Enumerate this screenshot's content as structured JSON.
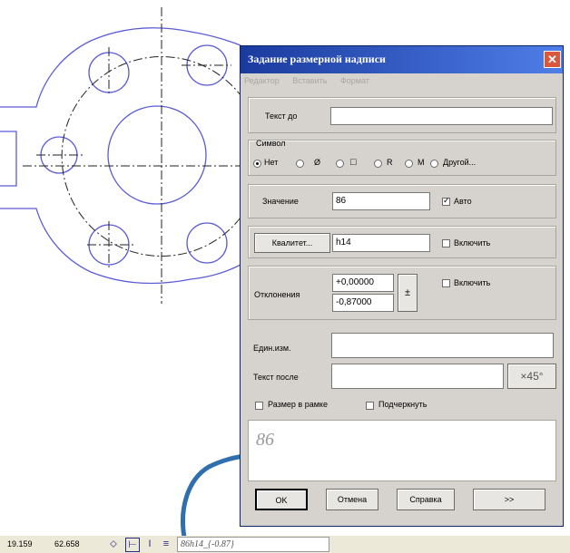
{
  "colors": {
    "drawing_line": "#5b5bd6",
    "center_line": "#222222",
    "title_gradient_start": "#1a3a9e",
    "title_gradient_end": "#4f7ee8",
    "close_button": "#d9583b",
    "arrow": "#2f6fad"
  },
  "dialog": {
    "title": "Задание размерной надписи",
    "close_icon": "✕",
    "menu": [
      "Редактор",
      "Вставить",
      "Формат"
    ],
    "text_before": {
      "label": "Текст до",
      "value": ""
    },
    "symbol": {
      "group_label": "Символ",
      "options": [
        {
          "label": "Нет",
          "selected": true
        },
        {
          "label": "Ø",
          "selected": false
        },
        {
          "label": "□",
          "selected": false
        },
        {
          "label": "R",
          "selected": false
        },
        {
          "label": "M",
          "selected": false
        },
        {
          "label": "Другой...",
          "selected": false
        }
      ]
    },
    "value": {
      "label": "Значение",
      "value": "86",
      "auto_label": "Авто",
      "auto_checked": true
    },
    "quality": {
      "button_label": "Квалитет...",
      "value": "h14",
      "enable_label": "Включить",
      "enable_checked": false
    },
    "deviations": {
      "label": "Отклонения",
      "upper": "+0,00000",
      "lower": "-0,87000",
      "pm_symbol": "±",
      "enable_label": "Включить",
      "enable_checked": false
    },
    "units": {
      "label": "Един.изм.",
      "value": ""
    },
    "text_after": {
      "label": "Текст после",
      "value": "",
      "angle_button": "×45°"
    },
    "size_in_frame": {
      "label": "Размер в рамке",
      "checked": false
    },
    "underline": {
      "label": "Подчеркнуть",
      "checked": false
    },
    "preview_value": "86",
    "buttons": {
      "ok": "OK",
      "cancel": "Отмена",
      "help": "Справка",
      "more": ">>"
    }
  },
  "statusbar": {
    "x": "19.159",
    "y": "62.658",
    "field_value": "86h14_{-0.87}"
  }
}
